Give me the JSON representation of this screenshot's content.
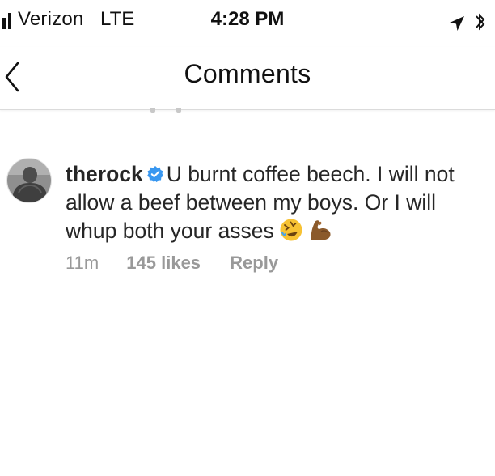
{
  "status_bar": {
    "carrier": "Verizon",
    "network": "LTE",
    "time": "4:28 PM",
    "icons": [
      "signal-bars-icon",
      "location-arrow-icon",
      "bluetooth-icon"
    ]
  },
  "header": {
    "back_icon": "chevron-left-icon",
    "title": "Comments"
  },
  "comment": {
    "avatar": "profile-photo",
    "username": "therock",
    "verified_icon": "verified-badge-icon",
    "text": "U burnt coffee beech. I will not allow a beef between my boys. Or I will whup both your asses",
    "emojis": [
      "rolling-on-floor-laughing-emoji",
      "flexed-biceps-emoji"
    ],
    "time": "11m",
    "likes": "145 likes",
    "reply_label": "Reply"
  },
  "colors": {
    "text": "#262626",
    "meta": "#999999",
    "verified": "#3897f0",
    "divider": "#dbdbdb"
  }
}
